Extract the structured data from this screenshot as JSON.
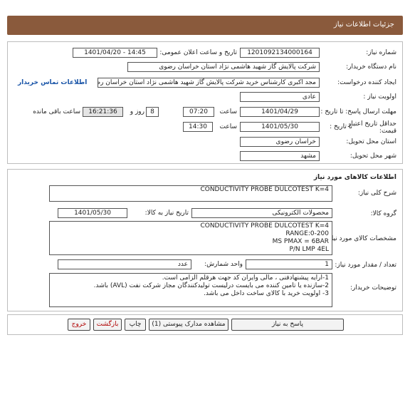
{
  "header": {
    "title": "جزئیات اطلاعات نیاز"
  },
  "info": {
    "need_number_label": "شماره نیاز:",
    "need_number": "1201092134000164",
    "announce_label": "تاریخ و ساعت اعلان عمومی:",
    "announce_value": "1401/04/20 - 14:45",
    "buyer_label": "نام دستگاه خریدار:",
    "buyer_value": "شرکت پالایش گاز شهید هاشمی نژاد   استان خراسان رضوی",
    "creator_label": "ایجاد کننده درخواست:",
    "creator_value": "مجد اکبری کارشناس خرید شرکت پالایش گاز شهید هاشمی نژاد   استان خراسان رضوی",
    "contact_link": "اطلاعات تماس خریدار",
    "priority_label": "اولویت نیاز :",
    "priority_value": "عادی",
    "deadline_label": "مهلت ارسال پاسخ: تا تاریخ :",
    "deadline_date": "1401/04/29",
    "time_label": "ساعت",
    "deadline_time": "07:20",
    "days_value": "8",
    "days_label": "روز و",
    "remaining_time": "16:21:36",
    "remaining_label": "ساعت باقی مانده",
    "validity_label_1": "حداقل تاریخ اعتبار",
    "validity_label_2": "قیمت:",
    "validity_to_label": "تا تاریخ :",
    "validity_date": "1401/05/30",
    "validity_time_label": "ساعت",
    "validity_time": "14:30",
    "province_label": "استان محل تحویل:",
    "province_value": "خراسان رضوی",
    "city_label": "شهر محل تحویل:",
    "city_value": "مشهد"
  },
  "goods": {
    "section_title": "اطلاعات کالاهای مورد نیاز",
    "summary_label": "شرح کلی نیاز:",
    "summary_value": "CONDUCTIVITY PROBE DULCOTEST K=4",
    "group_label": "گروه کالا:",
    "group_value": "محصولات الکترونیکی",
    "need_date_label": "تاریخ نیاز به کالا:",
    "need_date_value": "1401/05/30",
    "spec_label": "مشخصات کالای مورد نیاز:",
    "spec_lines": [
      "CONDUCTIVITY PROBE DULCOTEST K=4",
      "RANGE:0-200",
      "MS PMAX = 6BAR",
      "P/N LMP 4EL"
    ],
    "qty_label": "تعداد / مقدار مورد نیاز:",
    "qty_value": "1",
    "unit_label": "واحد شمارش:",
    "unit_value": "عدد",
    "notes_label": "توضیحات خریدار:",
    "notes_lines": [
      "1-ارایه پیشنهادفنی ، مالی وایران کد جهت هرقلم الزامی است.",
      "2-سازنده یا تامین کننده می بایست درلیست تولیدکنندگان مجاز شرکت نفت (AVL)  باشد.",
      "3- اولویت خرید  با کالای ساخت  داخل می باشد."
    ]
  },
  "actions": {
    "reply": "پاسخ به نیاز",
    "attachments": "مشاهده مدارک پیوستی (1)",
    "print": "چاپ",
    "back": "بازگشت",
    "exit": "خروج"
  }
}
